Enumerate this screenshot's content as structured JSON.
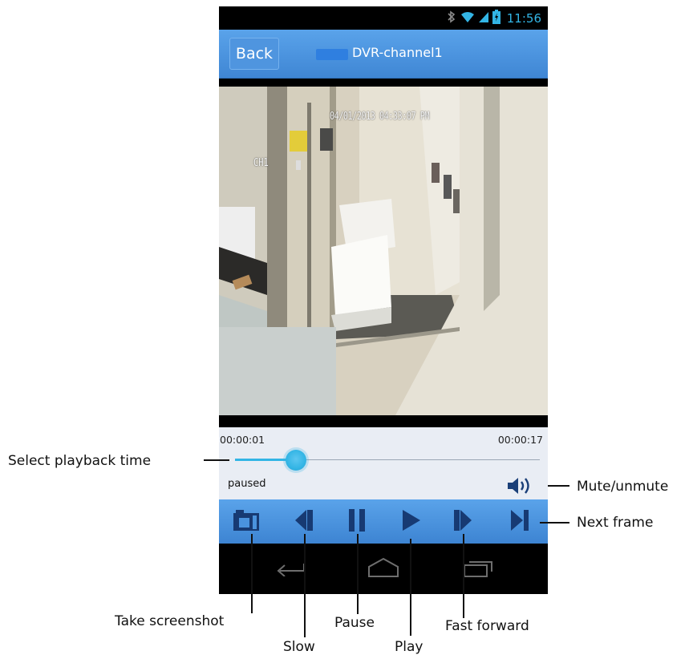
{
  "status_bar": {
    "time": "11:56",
    "icons": [
      "bluetooth-muted-icon",
      "wifi-icon",
      "signal-icon",
      "battery-icon"
    ],
    "accent": "#33b5e5"
  },
  "app_bar": {
    "back_label": "Back",
    "title": "DVR-channel1",
    "bar_color": "#4a93de"
  },
  "video": {
    "timestamp_overlay": "04/01/2013 04:33:07 PM",
    "channel_overlay": "CH1"
  },
  "playback": {
    "start_time": "00:00:01",
    "end_time": "00:00:17",
    "progress": 0.2,
    "status": "paused",
    "mute_icon": "speaker-icon"
  },
  "controls": [
    {
      "id": "screenshot",
      "icon": "camera-icon"
    },
    {
      "id": "slow",
      "icon": "rewind-icon"
    },
    {
      "id": "pause",
      "icon": "pause-icon"
    },
    {
      "id": "play",
      "icon": "play-icon"
    },
    {
      "id": "fast-forward",
      "icon": "fast-forward-icon"
    },
    {
      "id": "next-frame",
      "icon": "next-frame-icon"
    }
  ],
  "nav_bar": [
    "back-nav-icon",
    "home-nav-icon",
    "recent-apps-icon"
  ],
  "callouts": {
    "select_playback_time": "Select playback time",
    "mute_unmute": "Mute/unmute",
    "next_frame": "Next frame",
    "take_screenshot": "Take screenshot",
    "slow": "Slow",
    "pause": "Pause",
    "play": "Play",
    "fast_forward": "Fast forward"
  }
}
